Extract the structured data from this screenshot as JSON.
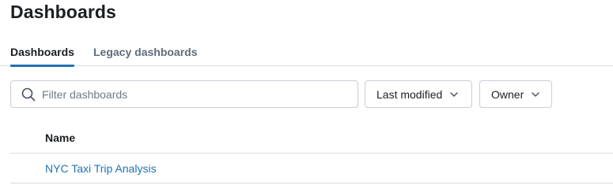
{
  "page": {
    "title": "Dashboards"
  },
  "tabs": [
    {
      "label": "Dashboards",
      "active": true
    },
    {
      "label": "Legacy dashboards",
      "active": false
    }
  ],
  "filters": {
    "search_placeholder": "Filter dashboards",
    "search_value": "",
    "sort_label": "Last modified",
    "owner_label": "Owner"
  },
  "table": {
    "columns": [
      "Name"
    ],
    "rows": [
      {
        "name": "NYC Taxi Trip Analysis"
      }
    ]
  },
  "colors": {
    "accent": "#2272b4",
    "border": "#d8dde3",
    "text": "#1b1f24",
    "muted": "#5f6b78"
  },
  "icons": {
    "search": "search-icon",
    "sort_chevron": "chevron-down-icon",
    "owner_chevron": "chevron-down-icon"
  }
}
